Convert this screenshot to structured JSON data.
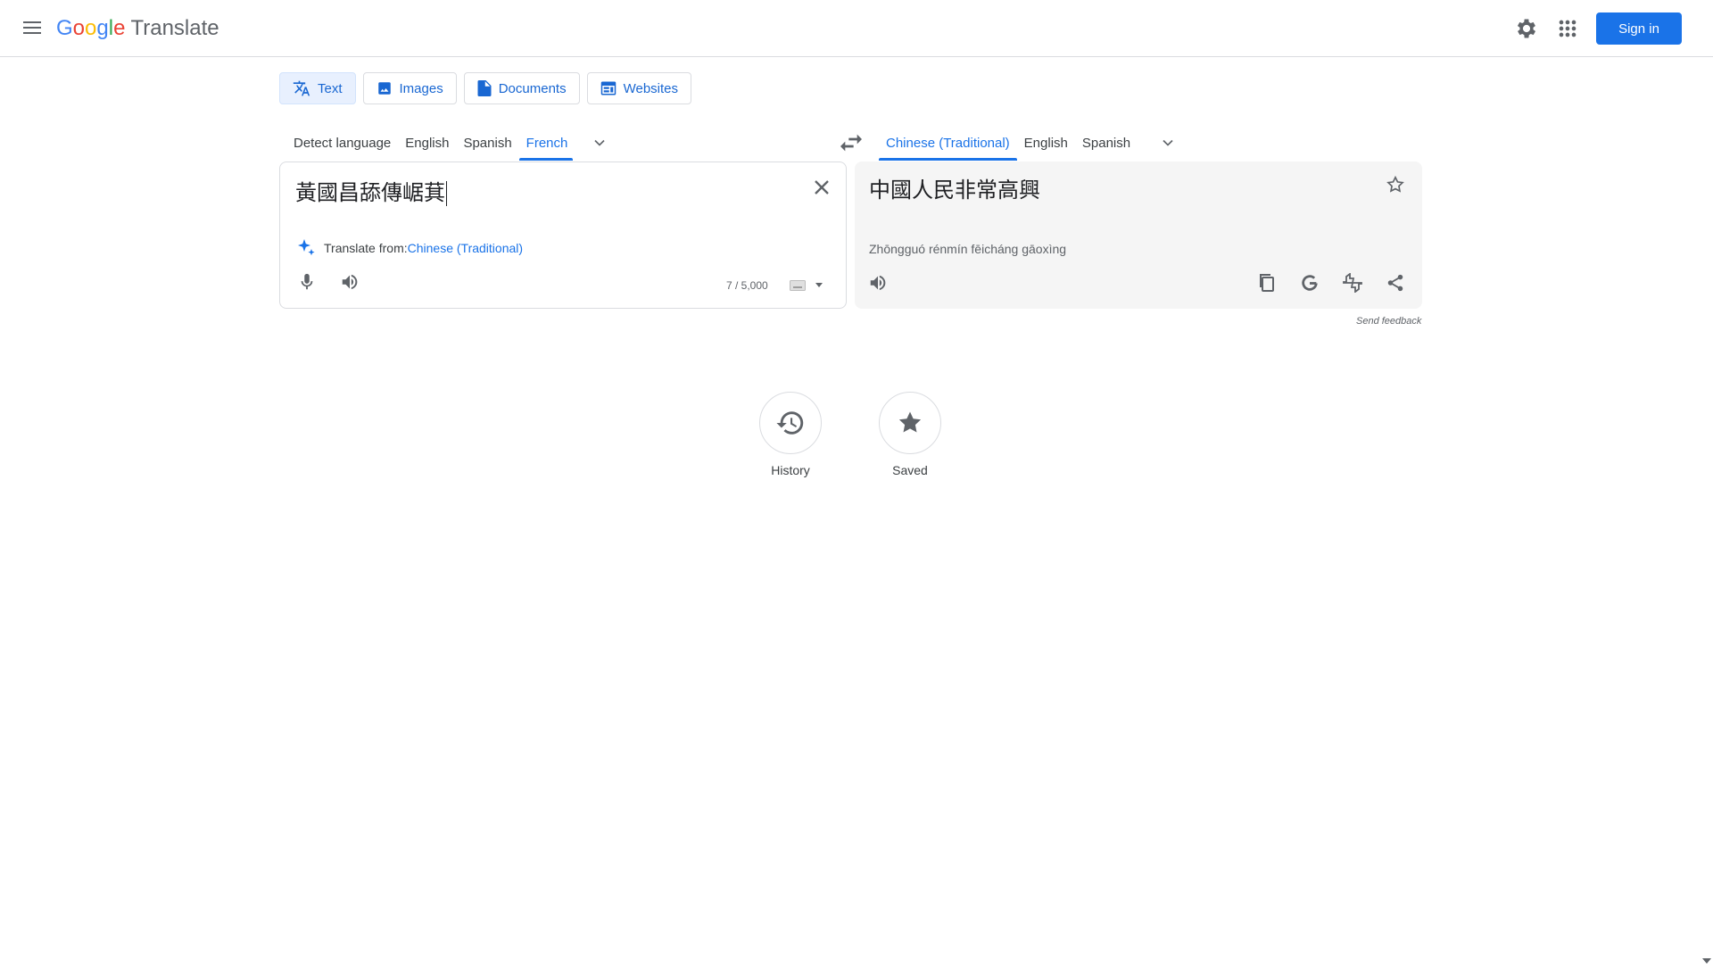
{
  "header": {
    "logo_letters": [
      "G",
      "o",
      "o",
      "g",
      "l",
      "e"
    ],
    "product": "Translate",
    "signin_label": "Sign in"
  },
  "modes": [
    {
      "label": "Text",
      "icon": "translate-icon",
      "active": true
    },
    {
      "label": "Images",
      "icon": "image-icon",
      "active": false
    },
    {
      "label": "Documents",
      "icon": "document-icon",
      "active": false
    },
    {
      "label": "Websites",
      "icon": "website-icon",
      "active": false
    }
  ],
  "source_languages": {
    "items": [
      "Detect language",
      "English",
      "Spanish",
      "French"
    ],
    "active": "French"
  },
  "target_languages": {
    "items": [
      "Chinese (Traditional)",
      "English",
      "Spanish"
    ],
    "active": "Chinese (Traditional)"
  },
  "source": {
    "text": "黃國昌舔傳崌萁",
    "suggest_prefix": "Translate from: ",
    "suggest_lang": "Chinese (Traditional)",
    "char_count": "7 / 5,000"
  },
  "target": {
    "text": "中國人民非常高興",
    "romanization": "Zhōngguó rénmín fēicháng gāoxìng"
  },
  "feedback": "Send feedback",
  "bottom": {
    "history_label": "History",
    "saved_label": "Saved"
  },
  "colors": {
    "accent": "#1a73e8",
    "border": "#dadce0",
    "target_bg": "#f5f5f5"
  }
}
